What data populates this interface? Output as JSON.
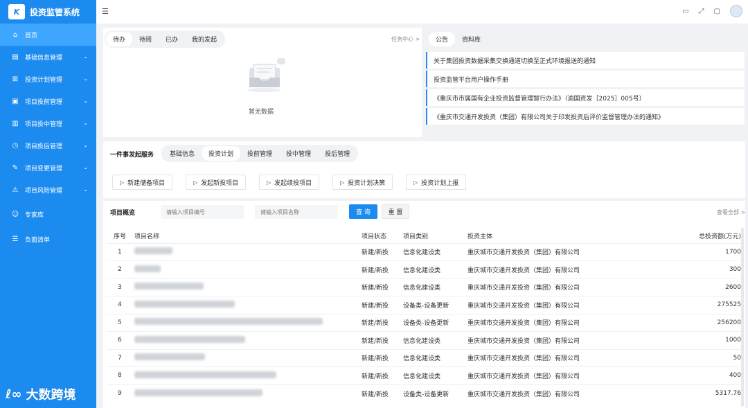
{
  "app": {
    "title": "投资监管系统",
    "logo_text": "K"
  },
  "sidebar": {
    "items": [
      {
        "label": "首页",
        "icon": "home-icon",
        "glyph": "⌂",
        "active": true,
        "expandable": false
      },
      {
        "label": "基础信息管理",
        "icon": "doc-icon",
        "glyph": "▤",
        "expandable": true
      },
      {
        "label": "投资计划管理",
        "icon": "grid-icon",
        "glyph": "⊞",
        "expandable": true
      },
      {
        "label": "项目投前管理",
        "icon": "briefcase-icon",
        "glyph": "▣",
        "expandable": true
      },
      {
        "label": "项目投中管理",
        "icon": "bar-chart-icon",
        "glyph": "▥",
        "expandable": true
      },
      {
        "label": "项目投后管理",
        "icon": "clock-icon",
        "glyph": "◷",
        "expandable": true
      },
      {
        "label": "项目变更管理",
        "icon": "edit-icon",
        "glyph": "✎",
        "expandable": true
      },
      {
        "label": "项目风险管理",
        "icon": "warning-icon",
        "glyph": "⚠",
        "expandable": true
      },
      {
        "label": "专家库",
        "icon": "user-icon",
        "glyph": "☺",
        "expandable": false
      },
      {
        "label": "负面清单",
        "icon": "list-icon",
        "glyph": "☰",
        "expandable": false
      }
    ]
  },
  "topbar": {
    "icons": [
      "monitor-icon",
      "fullscreen-icon",
      "message-icon",
      "avatar"
    ]
  },
  "tasks": {
    "tabs": [
      "待办",
      "待阅",
      "已办",
      "我的发起"
    ],
    "active_tab": 0,
    "more_label": "任务中心 >",
    "empty_text": "暂无数据"
  },
  "notices": {
    "tabs": [
      "公告",
      "资料库"
    ],
    "active_tab": 0,
    "items": [
      "关于集团投资数据采集交换通道切换至正式环境报送的通知",
      "投资监管平台用户操作手册",
      "《重庆市市属国有企业投资监督管理暂行办法》（渝国资发［2025］005号）",
      "《重庆市交通开发投资（集团）有限公司关于印发投资后评价监督管理办法的通知》"
    ]
  },
  "services": {
    "title": "一件事发起服务",
    "tabs": [
      "基础信息",
      "投资计划",
      "投前管理",
      "投中管理",
      "投后管理"
    ],
    "active_tab": 1,
    "actions": [
      "新建储备项目",
      "发起新投项目",
      "发起续投项目",
      "投资计划决策",
      "投资计划上报"
    ]
  },
  "overview": {
    "title": "项目概览",
    "search_code_placeholder": "请输入项目编号",
    "search_name_placeholder": "请输入项目名称",
    "query_label": "查 询",
    "reset_label": "重 置",
    "view_all_label": "查看全部 >",
    "columns": [
      "序号",
      "项目名称",
      "项目状态",
      "项目类别",
      "投资主体",
      "总投资额(万元)"
    ],
    "rows": [
      {
        "idx": "1",
        "name_blur": 55,
        "status": "新建/新投",
        "category": "信息化建设类",
        "entity": "重庆城市交通开发投资（集团）有限公司",
        "amount": "1700"
      },
      {
        "idx": "2",
        "name_blur": 38,
        "status": "新建/新投",
        "category": "信息化建设类",
        "entity": "重庆城市交通开发投资（集团）有限公司",
        "amount": "300"
      },
      {
        "idx": "3",
        "name_blur": 100,
        "status": "新建/新投",
        "category": "信息化建设类",
        "entity": "重庆城市交通开发投资（集团）有限公司",
        "amount": "2600"
      },
      {
        "idx": "4",
        "name_blur": 145,
        "status": "新建/新投",
        "category": "设备类-设备更新",
        "entity": "重庆城市交通开发投资（集团）有限公司",
        "amount": "275525"
      },
      {
        "idx": "5",
        "name_blur": 272,
        "status": "新建/新投",
        "category": "设备类-设备更新",
        "entity": "重庆城市交通开发投资（集团）有限公司",
        "amount": "256200"
      },
      {
        "idx": "6",
        "name_blur": 160,
        "status": "新建/新投",
        "category": "信息化建设类",
        "entity": "重庆城市交通开发投资（集团）有限公司",
        "amount": "1000"
      },
      {
        "idx": "7",
        "name_blur": 102,
        "status": "新建/新投",
        "category": "信息化建设类",
        "entity": "重庆城市交通开发投资（集团）有限公司",
        "amount": "50"
      },
      {
        "idx": "8",
        "name_blur": 205,
        "status": "新建/新投",
        "category": "信息化建设类",
        "entity": "重庆城市交通开发投资（集团）有限公司",
        "amount": "400"
      },
      {
        "idx": "9",
        "name_blur": 185,
        "status": "新建/新投",
        "category": "设备类-设备更新",
        "entity": "重庆城市交通开发投资（集团）有限公司",
        "amount": "5317.76"
      }
    ]
  },
  "watermark": {
    "text": "大数跨境",
    "mark": "ℓ∞"
  },
  "colors": {
    "primary": "#1c8bf0",
    "sidebar_active": "#3fa6ff",
    "page_bg": "#f0f2f5"
  }
}
